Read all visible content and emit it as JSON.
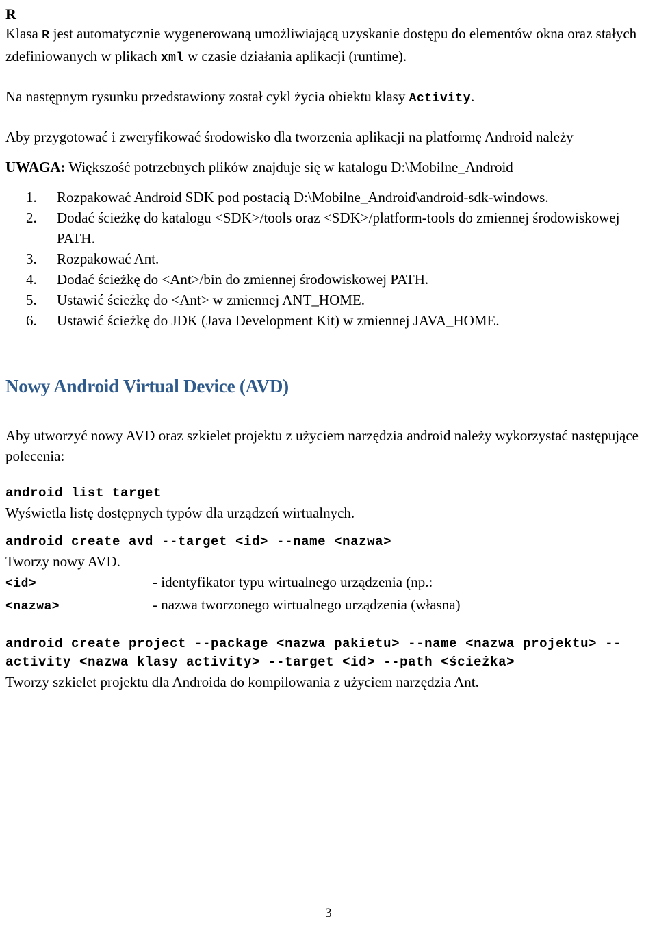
{
  "document": {
    "page_number": "3",
    "heading_color": "#2E5A8C",
    "top_heading": "R",
    "paragraph_1": {
      "part_1": "Klasa ",
      "code_1": "R",
      "part_2": " jest automatycznie wygenerowaną umożliwiającą uzyskanie dostępu do elementów okna oraz stałych zdefiniowanych w plikach ",
      "code_2": "xml",
      "part_3": " w czasie działania aplikacji (runtime)."
    },
    "paragraph_2": {
      "part_1": "Na następnym rysunku przedstawiony został cykl życia obiektu klasy ",
      "code_1": "Activity",
      "part_2": "."
    },
    "paragraph_3": "Aby przygotować i zweryfikować środowisko dla tworzenia aplikacji na platformę Android należy",
    "note": {
      "label": "UWAGA:",
      "text": " Większość potrzebnych plików znajduje się w katalogu D:\\Mobilne_Android"
    },
    "steps": [
      "Rozpakować Android SDK pod postacią D:\\Mobilne_Android\\android-sdk-windows.",
      "Dodać ścieżkę do katalogu <SDK>/tools oraz <SDK>/platform-tools do zmiennej środowiskowej PATH.",
      "Rozpakować Ant.",
      "Dodać ścieżkę do <Ant>/bin do zmiennej środowiskowej PATH.",
      "Ustawić ścieżkę do <Ant> w zmiennej ANT_HOME.",
      "Ustawić ścieżkę do JDK (Java Development Kit) w zmiennej JAVA_HOME."
    ],
    "section_heading": "Nowy Android Virtual Device (AVD)",
    "paragraph_4": "Aby utworzyć nowy AVD oraz szkielet projektu z użyciem narzędzia android  należy wykorzystać następujące polecenia:",
    "command_1": {
      "code": "android list target",
      "description": "Wyświetla listę dostępnych typów dla urządzeń wirtualnych."
    },
    "command_2": {
      "code": "android create avd --target <id> --name <nazwa>",
      "description": "Tworzy nowy AVD."
    },
    "definitions": [
      {
        "term": "<id>",
        "desc": "- identyfikator typu wirtualnego urządzenia (np.:"
      },
      {
        "term": "<nazwa>",
        "desc": "- nazwa tworzonego wirtualnego urządzenia (własna)"
      }
    ],
    "command_3": {
      "code": "android create project --package <nazwa pakietu> --name <nazwa projektu> --activity <nazwa klasy activity> --target <id> --path <ścieżka>",
      "description": "Tworzy szkielet projektu dla Androida do kompilowania z użyciem narzędzia Ant."
    }
  }
}
